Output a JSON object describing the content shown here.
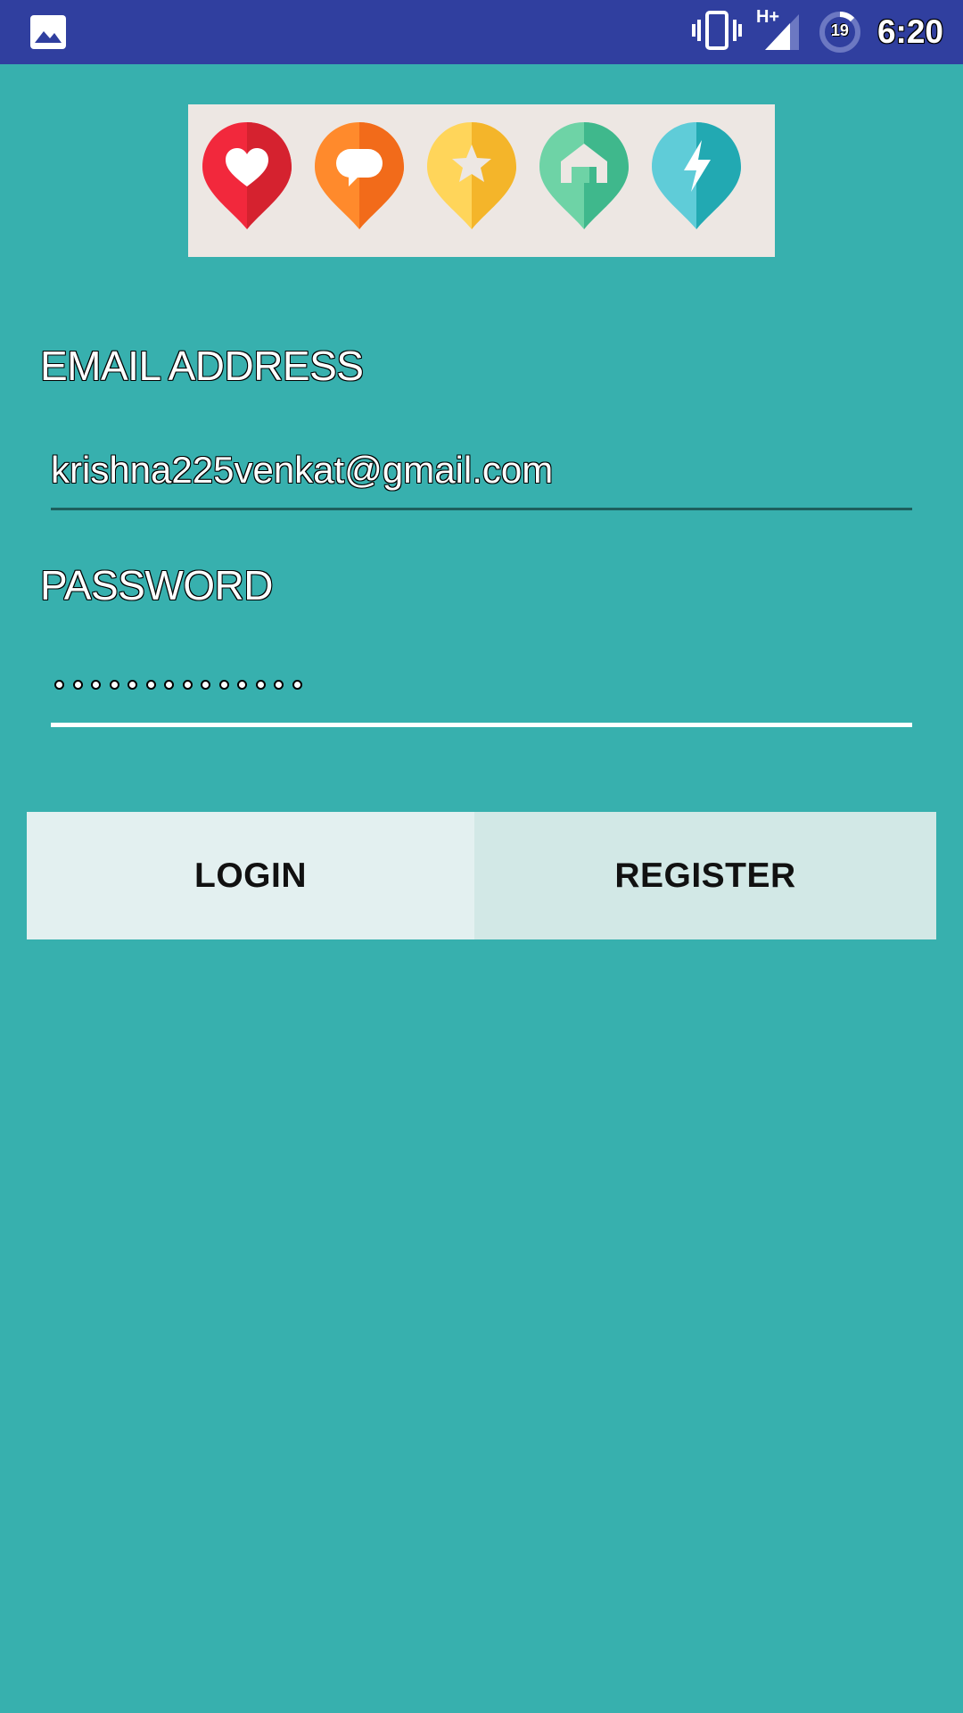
{
  "status_bar": {
    "time": "6:20",
    "network_label": "H+",
    "battery_level": "19",
    "background_color": "#303F9F",
    "icons": [
      "gallery-notification-icon",
      "vibrate-icon",
      "signal-icon",
      "battery-saver-icon"
    ]
  },
  "logo": {
    "background_color": "#EDE7E3",
    "pins": [
      {
        "icon": "heart-icon",
        "color": "#E8283A"
      },
      {
        "icon": "chat-bubble-icon",
        "color": "#FA7A22"
      },
      {
        "icon": "star-icon",
        "color": "#F7C12E"
      },
      {
        "icon": "home-icon",
        "color": "#4FC49A"
      },
      {
        "icon": "lightning-icon",
        "color": "#3BBBC7"
      }
    ]
  },
  "form": {
    "email_label": "EMAIL ADDRESS",
    "email_value": "krishna225venkat@gmail.com",
    "password_label": "PASSWORD",
    "password_masked": "••••••••••••••",
    "password_length": 14
  },
  "buttons": {
    "login_label": "LOGIN",
    "register_label": "REGISTER"
  },
  "theme": {
    "background": "#37B0AE",
    "accent_underline": "#ffffff"
  }
}
